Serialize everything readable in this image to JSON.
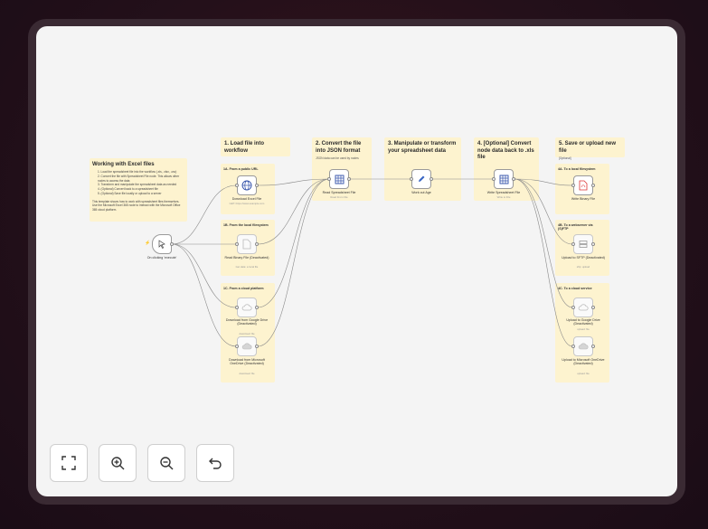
{
  "note": {
    "title": "Working with Excel files",
    "steps": [
      "1. Load the spreadsheet file into the workflow (.xls, .xlsx, .csv)",
      "2. Convert the file with Spreadsheet File node. This allows other nodes to access the data",
      "3. Transform and manipulate the spreadsheet data as needed",
      "4. (Optional) Convert back to a spreadsheet file",
      "5. (Optional) Save file locally or upload to a server"
    ],
    "footer": "This template shows how to work with spreadsheet files themselves. Use the Microsoft Excel 365 node to interact with the Microsoft Office 365 cloud platform."
  },
  "stickies": {
    "s1": {
      "title": "1. Load file into workflow",
      "sub": ""
    },
    "s2": {
      "title": "2. Convert the file into JSON format",
      "sub": "JSON data can be used by nodes"
    },
    "s3": {
      "title": "3. Manipulate or transform your spreadsheet data",
      "sub": ""
    },
    "s4": {
      "title": "4. [Optional] Convert node data back to .xls file",
      "sub": ""
    },
    "s5": {
      "title": "5. Save or upload new file",
      "sub": "[Optional]"
    }
  },
  "sections": {
    "a1": "1A. From a public URL",
    "b1": "1B. From the local filesystem",
    "c1": "1C. From a cloud platform",
    "a4": "4A. To a local filesystem",
    "b4": "4B. To a webserver via (S)FTP",
    "c4": "4C. To a cloud service"
  },
  "nodes": {
    "trigger": {
      "label": "On clicking 'execute'",
      "sub": ""
    },
    "download_excel": {
      "label": "Download Excel File",
      "sub": "GET: https://www.example.com"
    },
    "read_binary": {
      "label": "Read Binary File (Deactivated)",
      "sub": "Get data: a local file"
    },
    "gdrive_download": {
      "label": "Download from Google Drive (Deactivated)",
      "sub": "download: file"
    },
    "onedrive_download": {
      "label": "Download from Microsoft OneDrive (Deactivated)",
      "sub": "download: file"
    },
    "read_sheet": {
      "label": "Read Spreadsheet File",
      "sub": "Read From File"
    },
    "work_age": {
      "label": "Work out Age",
      "sub": ""
    },
    "write_sheet": {
      "label": "Write Spreadsheet File",
      "sub": "Write to File"
    },
    "write_binary": {
      "label": "Write Binary File",
      "sub": ""
    },
    "sftp": {
      "label": "Upload to SFTP (Deactivated)",
      "sub": "sftp: upload"
    },
    "gdrive_upload": {
      "label": "Upload to Google Drive (Deactivated)",
      "sub": "upload: file"
    },
    "onedrive_upload": {
      "label": "Upload to Microsoft OneDrive (Deactivated)",
      "sub": "upload: file"
    }
  },
  "controls": {
    "fit": "fit-to-view-icon",
    "zoom_in": "zoom-in-icon",
    "zoom_out": "zoom-out-icon",
    "reset": "undo-icon"
  },
  "colors": {
    "sticky": "#fdf3cf",
    "wire": "#8a8a8a",
    "trigger_bolt": "#ee3344",
    "spreadsheet": "#2f4ea8",
    "pen": "#3a66c4"
  }
}
